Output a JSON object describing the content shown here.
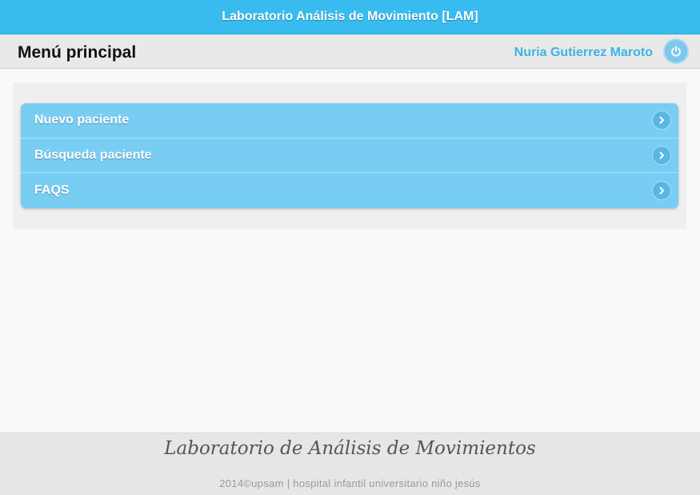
{
  "app": {
    "title": "Laboratorio Análisis de Movimiento [LAM]"
  },
  "header": {
    "title": "Menú principal",
    "user_name": "Nuria Gutierrez Maroto",
    "logout_icon": "power-icon"
  },
  "menu": {
    "items": [
      {
        "label": "Nuevo paciente",
        "icon": "chevron-right-icon"
      },
      {
        "label": "Búsqueda paciente",
        "icon": "chevron-right-icon"
      },
      {
        "label": "FAQS",
        "icon": "chevron-right-icon"
      }
    ]
  },
  "footer": {
    "brand": "Laboratorio de Análisis de Movimientos",
    "copyright": "2014©upsam | hospital infantil universitario niño jesús"
  },
  "colors": {
    "topbar": "#38bcf0",
    "menu": "#78cdf3",
    "user_name": "#3bb4e6"
  }
}
